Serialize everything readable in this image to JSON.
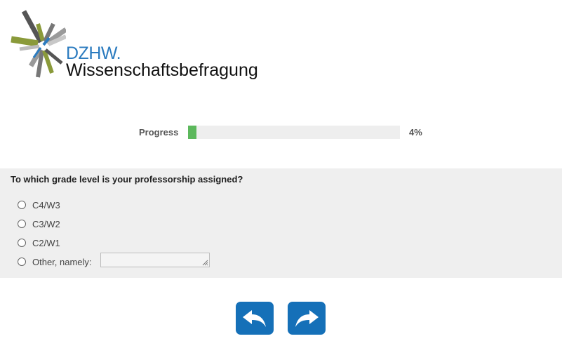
{
  "logo": {
    "brand": "DZHW.",
    "subtitle": "Wissenschaftsbefragung"
  },
  "progress": {
    "label": "Progress",
    "value_text": "4%",
    "fraction": 0.04,
    "fill_color": "#5cb85c"
  },
  "question": {
    "text": "To which grade level is your professorship assigned?",
    "options": [
      {
        "label": "C4/W3",
        "selected": false
      },
      {
        "label": "C3/W2",
        "selected": false
      },
      {
        "label": "C2/W1",
        "selected": false
      },
      {
        "label": "Other, namely:",
        "selected": false
      }
    ],
    "other_value": ""
  },
  "nav": {
    "back_icon": "undo-arrow-icon",
    "next_icon": "redo-arrow-icon",
    "button_color": "#1570b8"
  }
}
